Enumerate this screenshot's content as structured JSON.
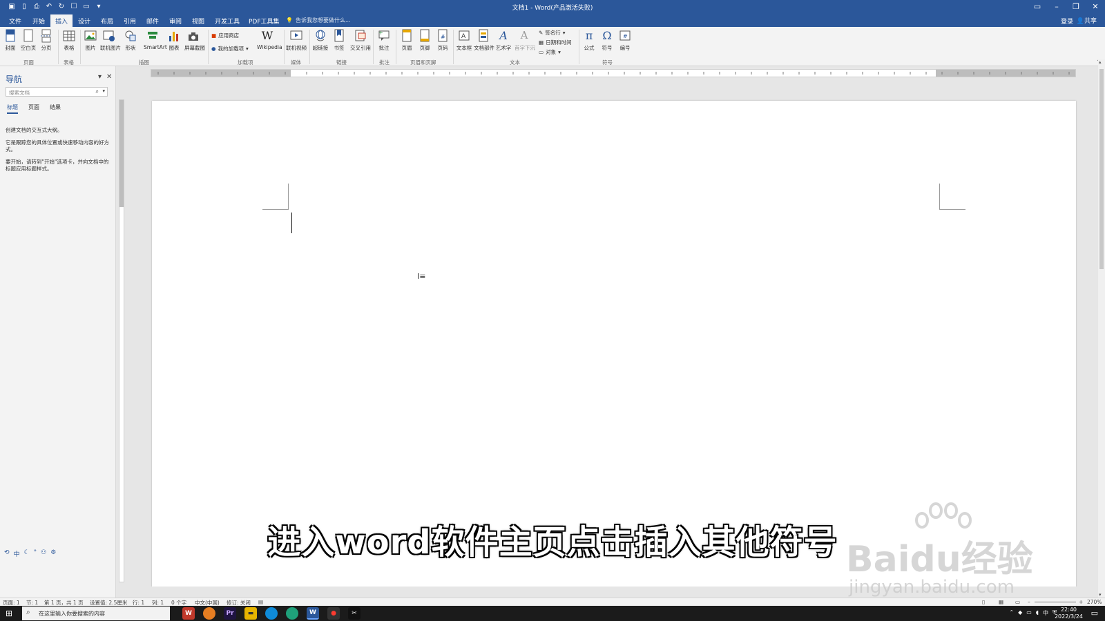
{
  "window": {
    "title": "文档1 - Word(产品激活失败)",
    "qat_icons": [
      "save-icon",
      "new-doc-icon",
      "print-preview-icon",
      "undo-icon",
      "redo-icon",
      "touch-mode-icon",
      "open-icon",
      "customize-qat-icon"
    ]
  },
  "tabs": [
    {
      "label": "文件"
    },
    {
      "label": "开始"
    },
    {
      "label": "插入"
    },
    {
      "label": "设计"
    },
    {
      "label": "布局"
    },
    {
      "label": "引用"
    },
    {
      "label": "邮件"
    },
    {
      "label": "审阅"
    },
    {
      "label": "视图"
    },
    {
      "label": "开发工具"
    },
    {
      "label": "PDF工具集"
    }
  ],
  "active_tab": "插入",
  "tellme": "告诉我您想要做什么...",
  "account": {
    "login": "登录",
    "share": "共享"
  },
  "ribbon": {
    "buttons": {
      "cover": "封面",
      "blank": "空白页",
      "pagebreak": "分页",
      "table": "表格",
      "picture": "图片",
      "online_picture": "联机图片",
      "shapes": "形状",
      "smartart": "SmartArt",
      "chart": "图表",
      "screenshot": "屏幕截图",
      "store": "应用商店",
      "myaddins": "我的加载项",
      "wikipedia": "Wikipedia",
      "online_video": "联机视频",
      "hyperlink": "超链接",
      "bookmark": "书签",
      "crossref": "交叉引用",
      "comment": "批注",
      "header": "页眉",
      "footer": "页脚",
      "pagenum": "页码",
      "textbox": "文本框",
      "quickparts": "文档部件",
      "wordart": "艺术字",
      "dropcap": "首字下沉",
      "signature": "签名行",
      "datetime": "日期和时间",
      "object": "对象",
      "equation": "公式",
      "symbol": "符号",
      "number": "编号"
    },
    "groups": {
      "pages": "页面",
      "tables": "表格",
      "illustrations": "插图",
      "addins": "加载项",
      "media": "媒体",
      "links": "链接",
      "comments": "批注",
      "header_footer": "页眉和页脚",
      "text": "文本",
      "symbols": "符号"
    }
  },
  "nav": {
    "title": "导航",
    "search_placeholder": "搜索文档",
    "tabs": [
      "标题",
      "页面",
      "结果"
    ],
    "active_tab": "标题",
    "msg1": "创建文档的交互式大纲。",
    "msg2": "它是跟踪您的具体位置或快速移动内容的好方式。",
    "msg3": "要开始，请转到\"开始\"选项卡，并向文档中的标题应用标题样式。",
    "ime_icons": [
      "ime-toggle-icon",
      "ime-chinese-icon",
      "ime-moon-icon",
      "ime-punct-icon",
      "ime-user-icon",
      "ime-settings-icon"
    ]
  },
  "ruler": {
    "tabsel": "L"
  },
  "status": {
    "page": "页面: 1",
    "section": "节: 1",
    "pages": "第 1 页，共 1 页",
    "position": "设置值: 2.5厘米",
    "line": "行: 1",
    "col": "列: 1",
    "words": "0 个字",
    "lang": "中文(中国)",
    "track": "修订: 关闭",
    "zoom": "270%"
  },
  "taskbar": {
    "search": "在这里输入你要搜索的内容",
    "time": "22:40",
    "date": "2022/3/24",
    "ime": "中"
  },
  "overlay": {
    "subtitle": "进入word软件主页点击插入其他符号",
    "watermark_text": "Baidu经验",
    "watermark_url": "jingyan.baidu.com"
  },
  "colors": {
    "accent": "#2b579a"
  }
}
